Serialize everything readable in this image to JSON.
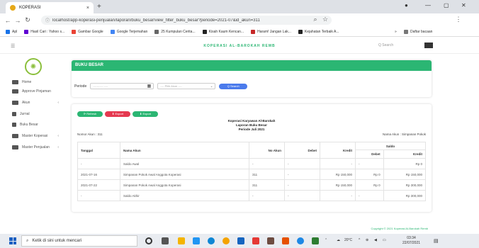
{
  "browser": {
    "tab_title": "KOPERASI",
    "tab_close": "×",
    "new_tab": "+",
    "url": "localhost/app-koperasi-penjualan/laporan/buku_besar/view_filter_buku_besar?periode=2021-07&id_akun=311",
    "bookmarks": [
      "Apl",
      "Hasil Cari : Yahoo s...",
      "Gambar Google",
      "Google Terjemahan",
      "25 Kumpulan Cerita...",
      "Kisah Kaum Kencan...",
      "Haram! Jangan Lak...",
      "Kejahatan Terbaik A...",
      "Daftar bacaan"
    ],
    "colors": {
      "tabbar": "#dee1e6"
    }
  },
  "header": {
    "brand": "KOPERASI AL-BAROKAH REMB",
    "search_placeholder": "Q  Search"
  },
  "sidebar": {
    "items": [
      {
        "label": "Home",
        "icon": "home-icon",
        "chevron": ""
      },
      {
        "label": "Approve Pinjaman",
        "icon": "users-icon",
        "chevron": ""
      },
      {
        "label": "Akun",
        "icon": "folder-icon",
        "chevron": "‹"
      },
      {
        "label": "Jurnal",
        "icon": "file-icon",
        "chevron": ""
      },
      {
        "label": "Buku Besar",
        "icon": "book-icon",
        "chevron": ""
      },
      {
        "label": "Master Koperasi",
        "icon": "folder-icon",
        "chevron": "‹"
      },
      {
        "label": "Master Penjualan",
        "icon": "folder-icon",
        "chevron": "‹"
      }
    ]
  },
  "main": {
    "title": "BUKU BESAR",
    "filter": {
      "periode_label": "Periode",
      "date_placeholder": "----------- ----",
      "select_placeholder": "---- Pilih Akun ----",
      "search_button": "Q Search"
    },
    "buttons": {
      "refresh": "⟳ Refresh",
      "export1": "⬇ Export",
      "export2": "⬇ Export"
    },
    "report": {
      "line1": "Koperasi Karyawan Al-Barokah",
      "line2": "Laporan Buku Besar",
      "line3": "Periode Juli 2021"
    },
    "nomor_akun": "Nomor Akun : 311",
    "nama_akun": "Nama Akun : Simpanan Pokok",
    "table": {
      "headers": {
        "tanggal": "Tanggal",
        "nama_akun": "Nama Akun",
        "no_akun": "No Akun",
        "debet": "Debet",
        "kredit": "Kredit",
        "saldo": "Saldo",
        "saldo_debet": "Debet",
        "saldo_kredit": "Kredit"
      },
      "rows": [
        [
          "-",
          "Saldo Awal",
          "-",
          "-",
          "-",
          "-",
          "Rp 0"
        ],
        [
          "2021-07-16",
          "Simpanan Pokok Awal Anggota Koperasi",
          "311",
          "-",
          "Rp 150,000",
          "Rp 0",
          "Rp 150,000"
        ],
        [
          "2021-07-22",
          "Simpanan Pokok Awal Anggota Koperasi",
          "311",
          "-",
          "Rp 150,000",
          "Rp 0",
          "Rp 300,000"
        ],
        [
          "-",
          "Saldo Akhir",
          "-",
          "-",
          "-",
          "-",
          "Rp 300,000"
        ]
      ]
    },
    "footer": "Copyright © 2021 Koperasi Al-Barokah Remb"
  },
  "taskbar": {
    "search_placeholder": "Ketik di sini untuk mencari",
    "weather": "20°C",
    "time": "03:34",
    "date": "22/07/2021"
  }
}
